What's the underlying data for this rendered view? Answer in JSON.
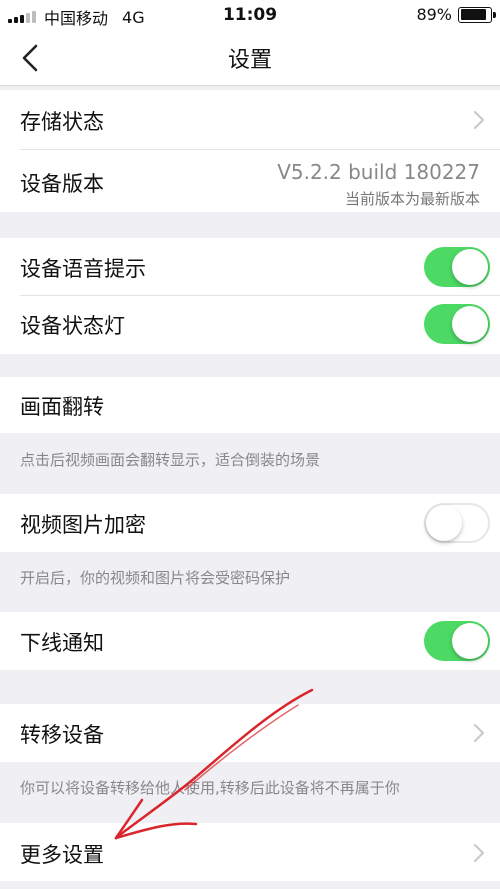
{
  "status_bar": {
    "carrier": "中国移动",
    "network": "4G",
    "time": "11:09",
    "battery_text": "89%",
    "battery_level": 0.89
  },
  "nav": {
    "title": "设置",
    "back_icon": "chevron-left-icon"
  },
  "rows": {
    "storage": {
      "label": "存储状态"
    },
    "version": {
      "label": "设备版本",
      "value": "V5.2.2 build 180227",
      "note": "当前版本为最新版本"
    },
    "voice_prompt": {
      "label": "设备语音提示",
      "enabled": true
    },
    "status_light": {
      "label": "设备状态灯",
      "enabled": true
    },
    "flip": {
      "label": "画面翻转",
      "hint": "点击后视频画面会翻转显示，适合倒装的场景"
    },
    "encrypt": {
      "label": "视频图片加密",
      "enabled": false,
      "hint": "开启后，你的视频和图片将会受密码保护"
    },
    "offline_notify": {
      "label": "下线通知",
      "enabled": true
    },
    "transfer": {
      "label": "转移设备",
      "hint": "你可以将设备转移给他人使用,转移后此设备将不再属于你"
    },
    "more": {
      "label": "更多设置"
    }
  },
  "colors": {
    "toggle_on": "#4cd964",
    "background": "#efeff4",
    "annotation_stroke": "#d9262c"
  }
}
